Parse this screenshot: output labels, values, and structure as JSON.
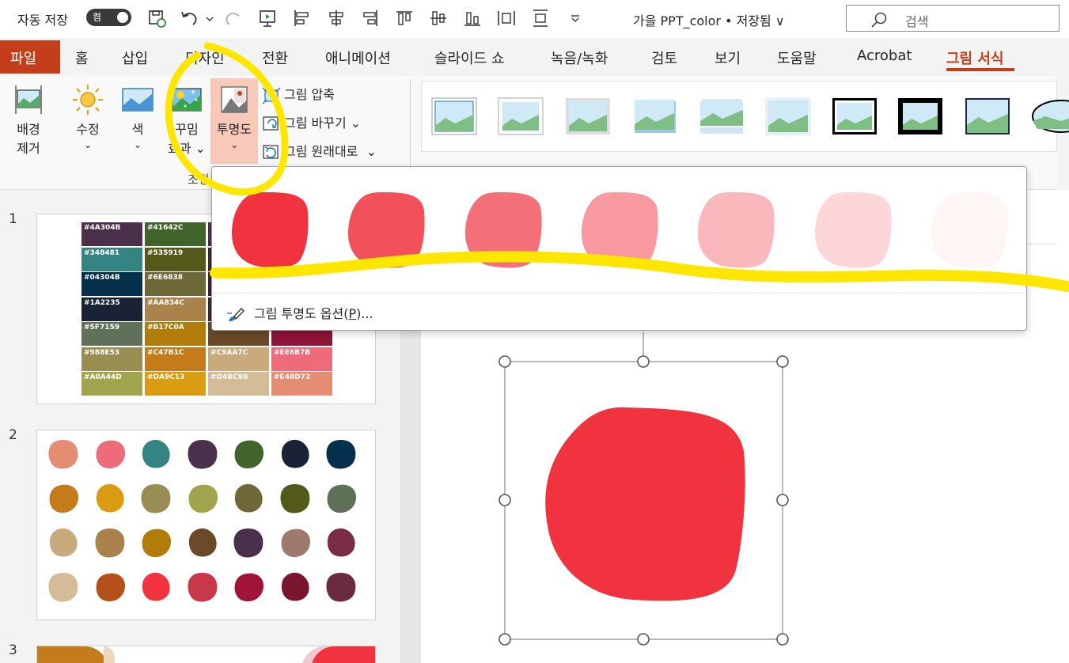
{
  "titlebar": {
    "autosave_label": "자동 저장",
    "autosave_state": "켬",
    "doc_title": "가을 PPT_color • 저장됨 ∨",
    "search_placeholder": "검색"
  },
  "tabs": {
    "file": "파일",
    "items": [
      "홈",
      "삽입",
      "디자인",
      "전환",
      "애니메이션",
      "슬라이드 쇼",
      "녹음/녹화",
      "검토",
      "보기",
      "도움말",
      "Acrobat"
    ],
    "active": "그림 서식"
  },
  "ribbon": {
    "remove_bg": [
      "배경",
      "제거"
    ],
    "corrections": "수정",
    "color": "색",
    "artistic": [
      "꾸밈",
      "효과"
    ],
    "transparency": "투명도",
    "compress": "그림 압축",
    "change": "그림 바꾸기",
    "reset": "그림 원래대로",
    "group_label": "조정"
  },
  "dropdown": {
    "option_label": "그림 투명도 옵션",
    "option_key": "P",
    "option_suffix": "...",
    "preset_transparency": [
      0,
      0.15,
      0.3,
      0.5,
      0.65,
      0.8,
      0.95
    ],
    "base_color": "#F0333F"
  },
  "slides": {
    "numbers": [
      "1",
      "2",
      "3"
    ],
    "palette": [
      [
        {
          "hex": "#4A304B",
          "label": "#4A304B"
        },
        {
          "hex": "#41642C",
          "label": "#41642C"
        },
        {
          "hex": "#55304A",
          "label": ""
        },
        {
          "hex": "#6E2A40",
          "label": ""
        }
      ],
      [
        {
          "hex": "#348481",
          "label": "#348481"
        },
        {
          "hex": "#535919",
          "label": "#535919"
        },
        {
          "hex": "#3C2A3A",
          "label": ""
        },
        {
          "hex": "#7A2B47",
          "label": ""
        }
      ],
      [
        {
          "hex": "#04304B",
          "label": "#04304B"
        },
        {
          "hex": "#6E6838",
          "label": "#6E6838"
        },
        {
          "hex": "#36263A",
          "label": ""
        },
        {
          "hex": "#7C2240",
          "label": ""
        }
      ],
      [
        {
          "hex": "#1A2235",
          "label": "#1A2235"
        },
        {
          "hex": "#AA834C",
          "label": "#AA834C"
        },
        {
          "hex": "#3A2A2A",
          "label": ""
        },
        {
          "hex": "#8A1E38",
          "label": ""
        }
      ],
      [
        {
          "hex": "#5F7159",
          "label": "#5F7159"
        },
        {
          "hex": "#B17C0A",
          "label": "#B17C0A"
        },
        {
          "hex": "#6B4A2A",
          "label": ""
        },
        {
          "hex": "#8E1538",
          "label": ""
        }
      ],
      [
        {
          "hex": "#988E53",
          "label": "#988E53"
        },
        {
          "hex": "#C47B1C",
          "label": "#C47B1C"
        },
        {
          "hex": "#C9AA7C",
          "label": "#C9AA7C"
        },
        {
          "hex": "#EE6B7B",
          "label": "#EE6B7B"
        }
      ],
      [
        {
          "hex": "#A0A44D",
          "label": "#A0A44D"
        },
        {
          "hex": "#DA9C13",
          "label": "#DA9C13"
        },
        {
          "hex": "#D4BC98",
          "label": "#D4BC98"
        },
        {
          "hex": "#E48D72",
          "label": "#E48D72"
        }
      ]
    ],
    "blobs": [
      [
        "#E48D72",
        "#EE6B7B",
        "#348481",
        "#4A304B",
        "#41642C",
        "#1A2235",
        "#04304B"
      ],
      [
        "#C47B1C",
        "#DA9C13",
        "#988E53",
        "#A0A44D",
        "#6E6838",
        "#535919",
        "#5F7159"
      ],
      [
        "#C9AA7C",
        "#AA834C",
        "#B17C0A",
        "#6B4A2A",
        "#4A304B",
        "#9E7A6E",
        "#7A2B47"
      ],
      [
        "#D4BC98",
        "#B4501C",
        "#F0333F",
        "#C9374A",
        "#A0143A",
        "#7A1530",
        "#6B2A3E"
      ]
    ]
  },
  "canvas": {
    "shape_color": "#F0333F"
  },
  "colors": {
    "accent": "#C43E1C",
    "highlight": "#FFE600",
    "button_active": "#F8C9B9"
  }
}
